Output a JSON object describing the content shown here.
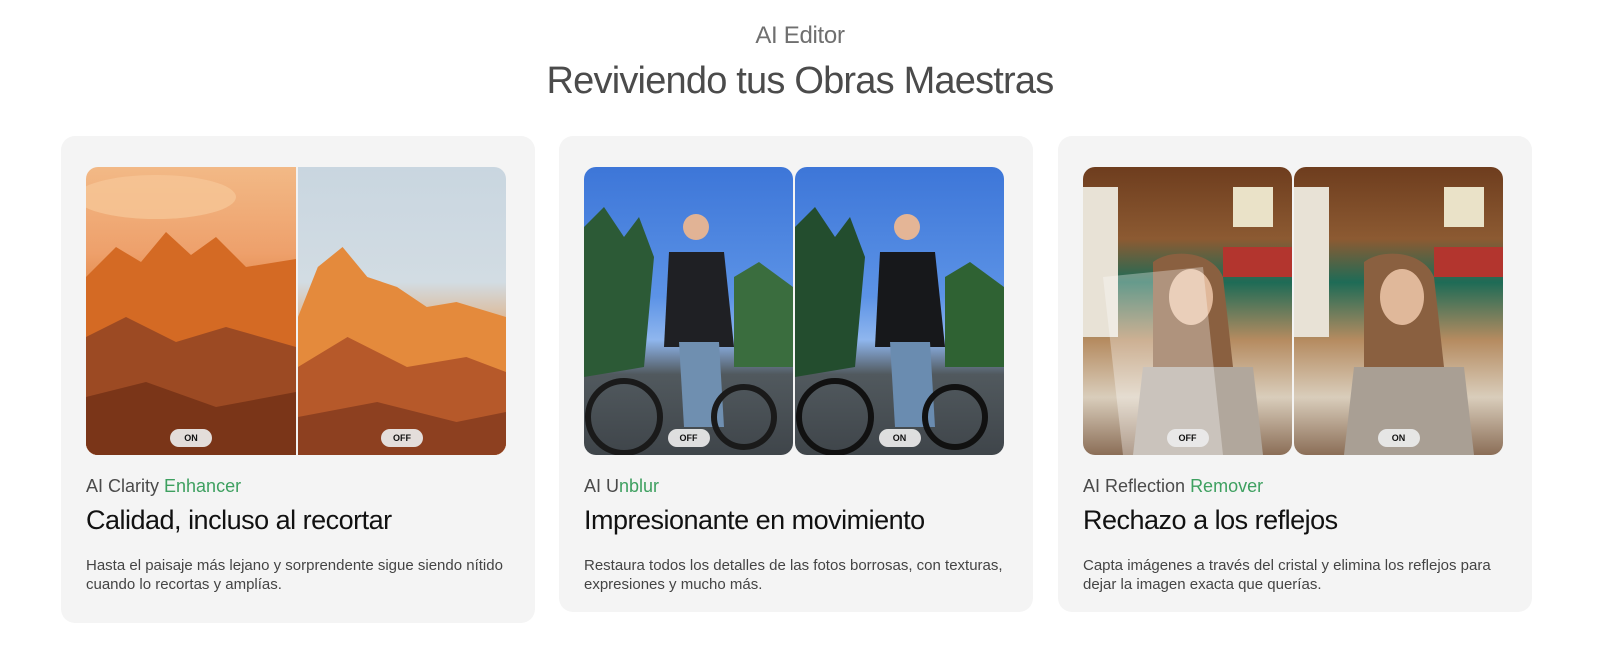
{
  "header": {
    "eyebrow": "AI Editor",
    "headline": "Reviviendo tus Obras Maestras"
  },
  "cards": [
    {
      "feature_prefix": "AI Clarity ",
      "feature_accent": "Enhancer",
      "title": "Calidad, incluso al recortar",
      "description": "Hasta el paisaje más lejano y sorprendente sigue siendo nítido cuando lo recortas y amplías.",
      "left_toggle": "ON",
      "right_toggle": "OFF"
    },
    {
      "feature_prefix": "AI U",
      "feature_accent": "nblur",
      "title": "Impresionante en movimiento",
      "description": "Restaura todos los detalles de las fotos borrosas, con texturas, expresiones y mucho más.",
      "left_toggle": "OFF",
      "right_toggle": "ON"
    },
    {
      "feature_prefix": "AI Reflection ",
      "feature_accent": "Remover",
      "title": "Rechazo a los reflejos",
      "description": "Capta imágenes a través del cristal y elimina los reflejos para dejar la imagen exacta que querías.",
      "left_toggle": "OFF",
      "right_toggle": "ON"
    }
  ],
  "colors": {
    "accent_green": "#3ea060",
    "card_bg": "#f4f4f4",
    "heading_gray": "#4b4b4b"
  }
}
